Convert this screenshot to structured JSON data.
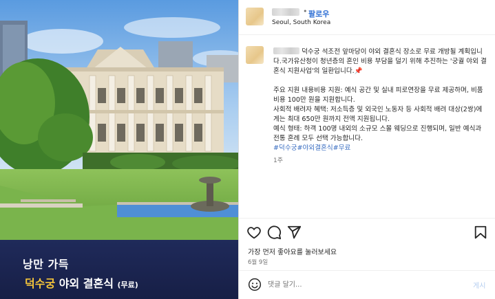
{
  "image": {
    "caption_line1": "낭만 가득",
    "caption_line2_highlight": "덕수궁",
    "caption_line2_rest": " 야외 결혼식 ",
    "caption_line2_small": "(무료)",
    "colors": {
      "caption_bg": "#1c2450",
      "highlight": "#f5c53a"
    }
  },
  "header": {
    "follow_separator": "•",
    "follow_label": "팔로우",
    "location": "Seoul, South Korea"
  },
  "post": {
    "intro": "덕수궁 석조전 앞마당이 야외 결혼식 장소로 무료 개방될 계획입니다.국가유산청이 청년층의 혼인 비용 부담을 덜기 위해 추진하는 '궁궐 야외 결혼식 지원사업'의 일환입니다.",
    "pin_emoji": "📌",
    "support": "주요 지원 내용비용 지원: 예식 공간 및 실내 피로연장을 무료 제공하며, 비품 비용 100만 원을 지원합니다.",
    "social": "사회적 배려자 혜택: 저소득층 및 외국인 노동자 등 사회적 배려 대상(2쌍)에게는 최대 650만 원까지 전액 지원됩니다.",
    "format": "예식 형태: 하객 100명 내외의 소규모 스몰 웨딩으로 진행되며, 일반 예식과 전통 혼례 모두 선택 가능합니다.",
    "hashtags": "#덕수궁#야외결혼식#무료",
    "age": "1주"
  },
  "actions": {
    "icons": [
      "heart-icon",
      "comment-icon",
      "share-icon",
      "bookmark-icon"
    ],
    "likes_first": "가장 먼저 좋아요를 눌러보세요",
    "date": "6월 9일"
  },
  "comment": {
    "placeholder": "댓글 달기...",
    "post_label": "게시"
  }
}
